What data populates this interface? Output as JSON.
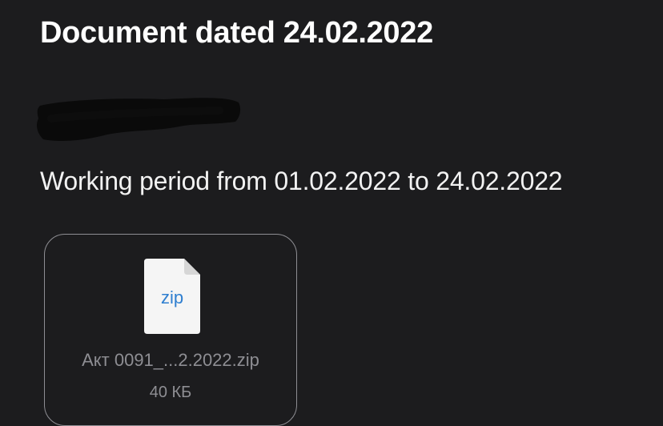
{
  "message": {
    "title": "Document dated 24.02.2022",
    "period": "Working period from 01.02.2022 to 24.02.2022"
  },
  "attachment": {
    "icon": "zip-file-icon",
    "icon_label": "zip",
    "file_name": "Акт 0091_...2.2022.zip",
    "file_size": "40 КБ"
  },
  "colors": {
    "background": "#1c1c1e",
    "text_primary": "#ffffff",
    "text_secondary": "#8e8e93",
    "zip_label": "#2f7fd0",
    "redaction": "#0a0a0a"
  }
}
